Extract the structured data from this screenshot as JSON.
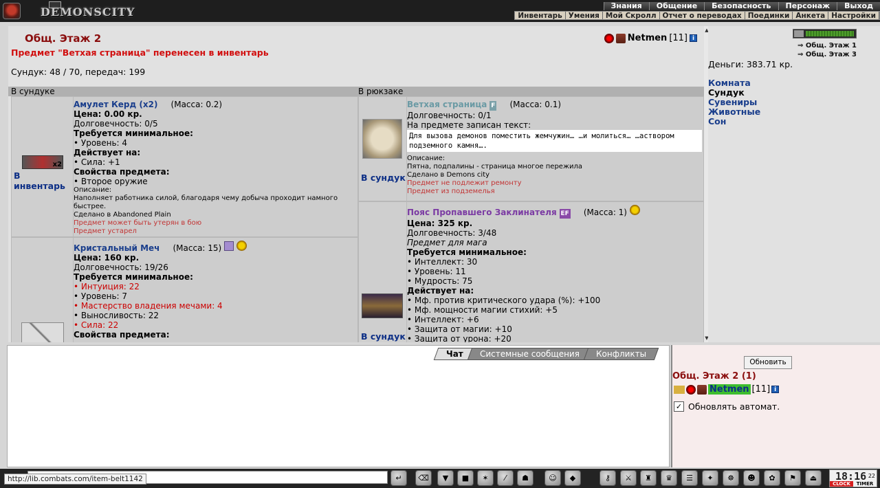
{
  "nav": {
    "main": [
      "Знания",
      "Общение",
      "Безопасность",
      "Персонаж",
      "Выход"
    ],
    "sub": [
      "Инвентарь",
      "Умения",
      "Мой Скролл",
      "Отчет о переводах",
      "Поединки",
      "Анкета",
      "Настройки"
    ],
    "logo_text": "DEMONSCITY"
  },
  "header": {
    "room": "Общ. Этаж 2",
    "user": "Netmen",
    "level": "[11]",
    "info": "i",
    "message": "Предмет \"Ветхая страница\" перенесен в инвентарь",
    "chest_stats": "Сундук: 48 / 70, передач: 199"
  },
  "labels": {
    "in_chest": "В сундуке",
    "in_backpack": "В рюкзаке",
    "to_inventory": "В инвентарь",
    "to_chest": "В сундук"
  },
  "chest_items": [
    {
      "name": "Амулет Керд (x2)",
      "mass": "(Масса: 0.2)",
      "price": "Цена: 0.00 кр.",
      "dur": "Долговечность: 0/5",
      "req_title": "Требуется минимальное:",
      "req": [
        "• Уровень: 4"
      ],
      "eff_title": "Действует на:",
      "eff": [
        "• Сила: +1"
      ],
      "prop_title": "Свойства предмета:",
      "props": [
        "• Второе оружие"
      ],
      "desc_title": "Описание:",
      "desc": "Наполняет работника силой, благодаря чему добыча проходит намного быстрее.",
      "made": "Сделано в Abandoned Plain",
      "warn": [
        "Предмет может быть утерян в бою",
        "Предмет устарел"
      ],
      "count": "x2"
    },
    {
      "name": "Кристальный Меч",
      "mass": "(Масса: 15)",
      "price": "Цена: 160 кр.",
      "dur": "Долговечность: 19/26",
      "req_title": "Требуется минимальное:",
      "req": [
        "• Интуиция: 22",
        "• Уровень: 7",
        "• Мастерство владения мечами: 4",
        "• Выносливость: 22",
        "• Сила: 22"
      ],
      "prop_title": "Свойства предмета:"
    }
  ],
  "backpack_items": [
    {
      "name": "Ветхая страница",
      "badge": "F",
      "mass": "(Масса: 0.1)",
      "dur": "Долговечность: 0/1",
      "text_title": "На предмете записан текст:",
      "text_lines": [
        "Для вызова демонов поместить жемчужин… …и молиться… …аствором",
        "подземного камня…."
      ],
      "desc_title": "Описание:",
      "desc": "Пятна, подпалины - страница многое пережила",
      "made": "Сделано в Demons city",
      "warn": [
        "Предмет не подлежит ремонту",
        "Предмет из подземелья"
      ]
    },
    {
      "name": "Пояс Пропавшего Заклинателя",
      "badge": "EF",
      "mass": "(Масса: 1)",
      "price": "Цена: 325 кр.",
      "dur": "Долговечность: 3/48",
      "class": "Предмет для мага",
      "req_title": "Требуется минимальное:",
      "req": [
        "• Интеллект: 30",
        "• Уровень: 11",
        "• Мудрость: 75"
      ],
      "eff_title": "Действует на:",
      "eff": [
        "• Мф. против критического удара (%): +100",
        "• Мф. мощности магии стихий: +5",
        "• Интеллект: +6",
        "• Защита от магии: +10",
        "• Защита от урона: +20"
      ]
    }
  ],
  "right": {
    "floors": [
      "Общ. Этаж 1",
      "Общ. Этаж 3"
    ],
    "money": "Деньги: 383.71 кр.",
    "links": [
      "Комната",
      "Сундук",
      "Сувениры",
      "Животные",
      "Сон"
    ]
  },
  "chat": {
    "tabs": [
      "Чат",
      "Системные сообщения",
      "Конфликты"
    ]
  },
  "side": {
    "refresh": "Обновить",
    "room": "Общ. Этаж 2 (1)",
    "user": "Netmen",
    "level": "[11]",
    "auto": "Обновлять автомат."
  },
  "status_url": "http://lib.combats.com/item-belt1142",
  "clock": {
    "time": "18:16",
    "sec": "22",
    "clock_label": "CLOCK",
    "timer_label": "TIMER"
  },
  "hp_fraction": 1.0
}
